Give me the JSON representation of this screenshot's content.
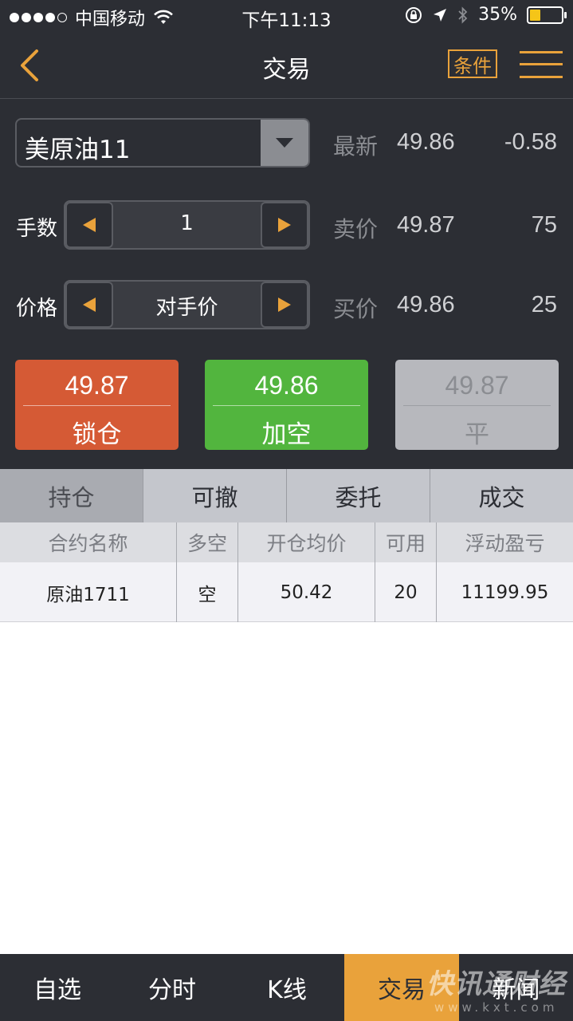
{
  "status_bar": {
    "carrier": "中国移动",
    "time": "下午11:13",
    "battery": "35%",
    "battery_level": 0.35,
    "signal_bars_filled": 4
  },
  "nav": {
    "title": "交易",
    "condition_label": "条件",
    "accent_color": "#e9a23b"
  },
  "contract": {
    "name": "美原油11"
  },
  "lots": {
    "label": "手数",
    "value": "1"
  },
  "price": {
    "label": "价格",
    "value": "对手价"
  },
  "quotes": {
    "latest": {
      "label": "最新",
      "price": "49.86",
      "change": "-0.58"
    },
    "ask": {
      "label": "卖价",
      "price": "49.87",
      "volume": "75"
    },
    "bid": {
      "label": "买价",
      "price": "49.86",
      "volume": "25"
    }
  },
  "actions": {
    "lock": {
      "price": "49.87",
      "label": "锁仓",
      "color": "#d55a35"
    },
    "short": {
      "price": "49.86",
      "label": "加空",
      "color": "#52b53e"
    },
    "flat": {
      "price": "49.87",
      "label": "平",
      "color": "#b7b8bd"
    }
  },
  "tabs": [
    "持仓",
    "可撤",
    "委托",
    "成交"
  ],
  "table": {
    "headers": [
      "合约名称",
      "多空",
      "开仓均价",
      "可用",
      "浮动盈亏"
    ],
    "rows": [
      [
        "原油1711",
        "空",
        "50.42",
        "20",
        "11199.95"
      ]
    ]
  },
  "bottom_nav": [
    "自选",
    "分时",
    "K线",
    "交易",
    "新闻"
  ],
  "watermark": {
    "text": "快讯通财经",
    "sub": "www.kxt.com"
  }
}
